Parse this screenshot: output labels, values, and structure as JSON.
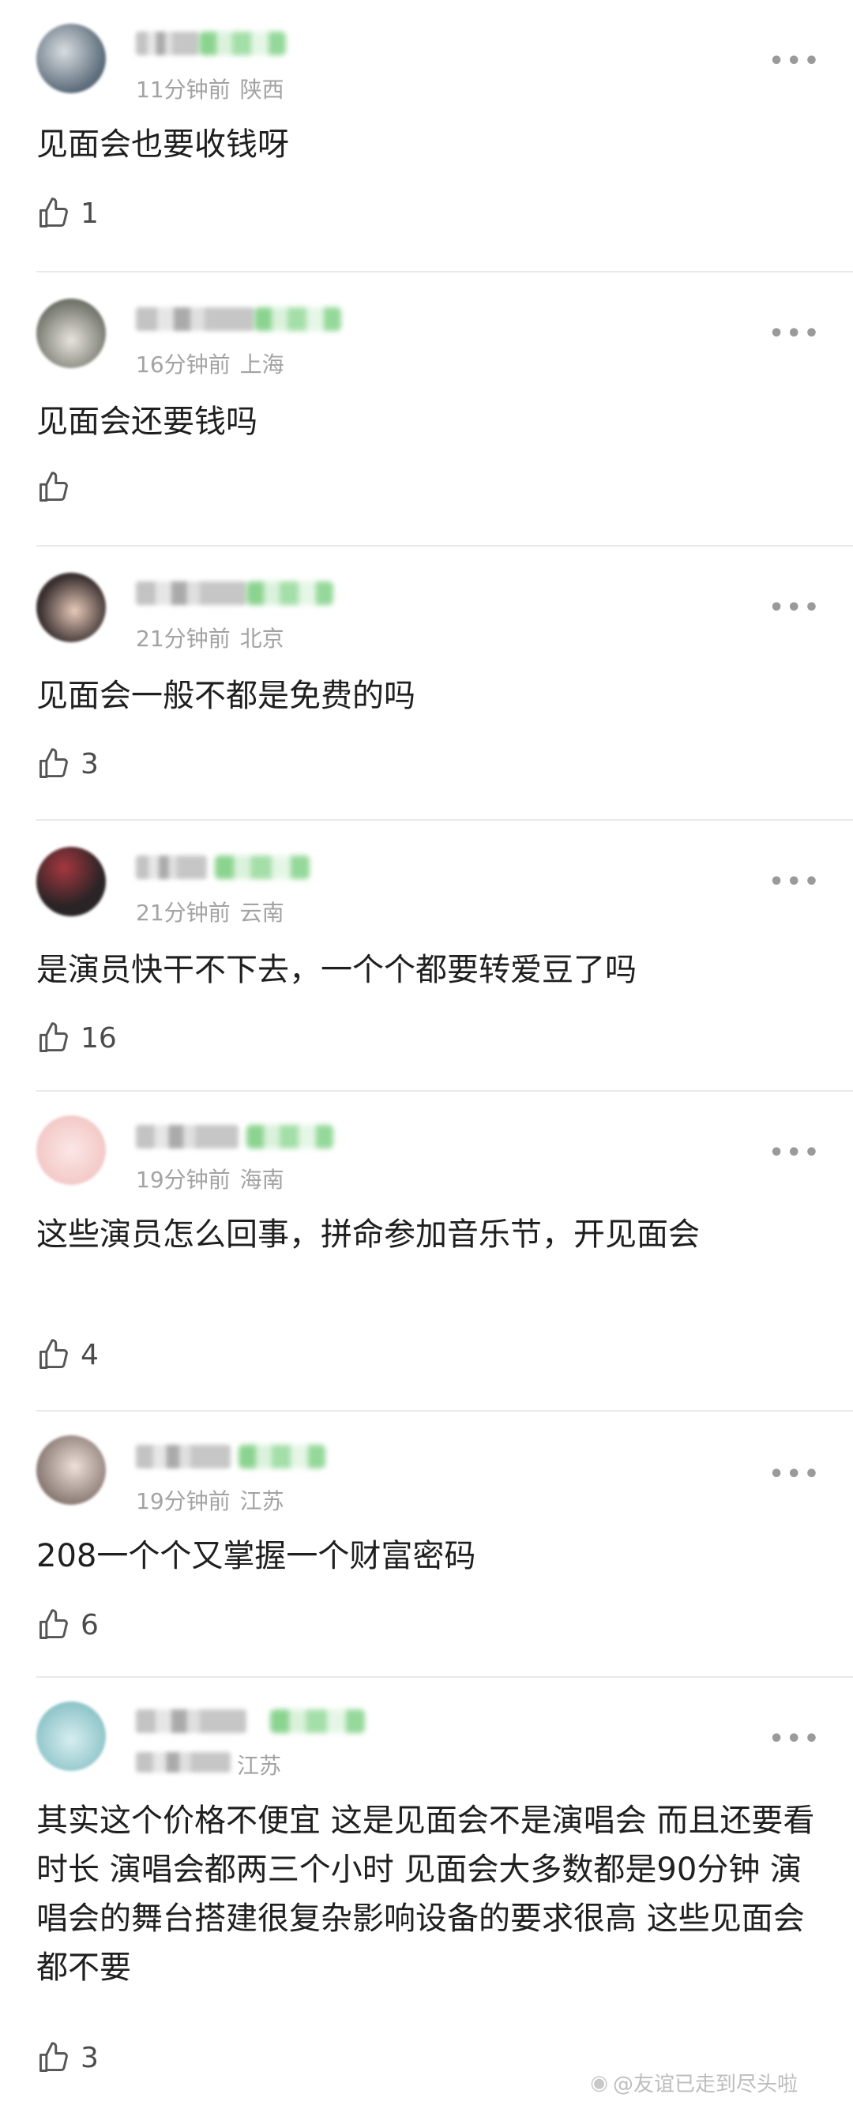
{
  "comments": [
    {
      "time": "11分钟前",
      "location": "陕西",
      "text": "见面会也要收钱呀",
      "likes": "1",
      "avatar_color": "#5b6b7a"
    },
    {
      "time": "16分钟前",
      "location": "上海",
      "text": "见面会还要钱吗",
      "likes": "",
      "avatar_color": "#6b6f65"
    },
    {
      "time": "21分钟前",
      "location": "北京",
      "text": "见面会一般不都是免费的吗",
      "likes": "3",
      "avatar_color": "#3a3030"
    },
    {
      "time": "21分钟前",
      "location": "云南",
      "text": "是演员快干不下去，一个个都要转爱豆了吗",
      "likes": "16",
      "avatar_color": "#2a2426"
    },
    {
      "time": "19分钟前",
      "location": "海南",
      "text": "这些演员怎么回事，拼命参加音乐节，开见面会",
      "likes": "4",
      "avatar_color": "#f3c9c7"
    },
    {
      "time": "19分钟前",
      "location": "江苏",
      "text": "208一个个又掌握一个财富密码",
      "likes": "6",
      "avatar_color": "#8a7a74"
    },
    {
      "time": "",
      "location": "江苏",
      "text": "其实这个价格不便宜 这是见面会不是演唱会 而且还要看时长 演唱会都两三个小时 见面会大多数都是90分钟 演唱会的舞台搭建很复杂影响设备的要求很高 这些见面会都不要",
      "likes": "3",
      "avatar_color": "#8fc5c9"
    }
  ],
  "more_icon": "more-dots-icon",
  "like_icon": "thumbs-up-icon",
  "watermark": {
    "icon": "weibo-icon",
    "text": "@友谊已走到尽头啦"
  }
}
